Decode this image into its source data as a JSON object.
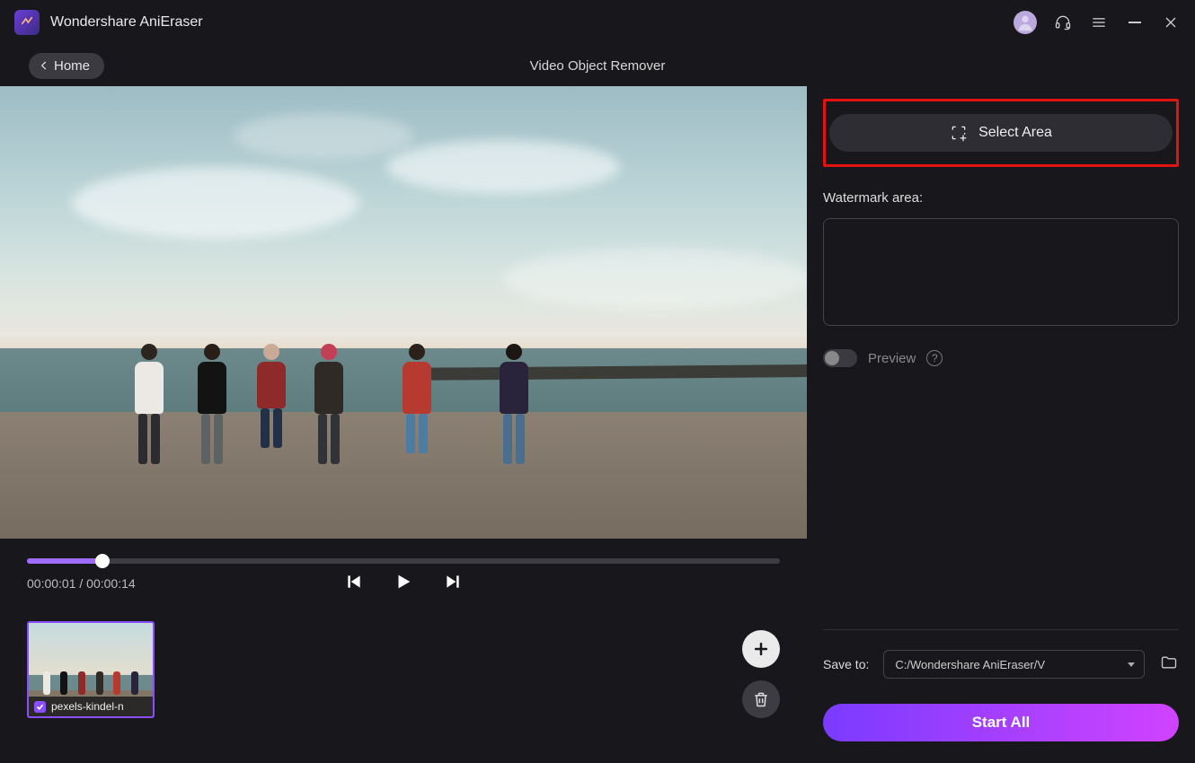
{
  "app": {
    "title": "Wondershare AniEraser"
  },
  "header": {
    "home": "Home",
    "page_title": "Video Object Remover"
  },
  "player": {
    "current": "00:00:01",
    "total": "00:00:14",
    "separator": " / ",
    "progress_pct": 10
  },
  "thumb": {
    "filename": "pexels-kindel-n"
  },
  "side": {
    "select_area": "Select Area",
    "watermark_label": "Watermark area:",
    "preview": "Preview",
    "save_label": "Save to:",
    "save_path": "C:/Wondershare AniEraser/V",
    "start": "Start All"
  }
}
